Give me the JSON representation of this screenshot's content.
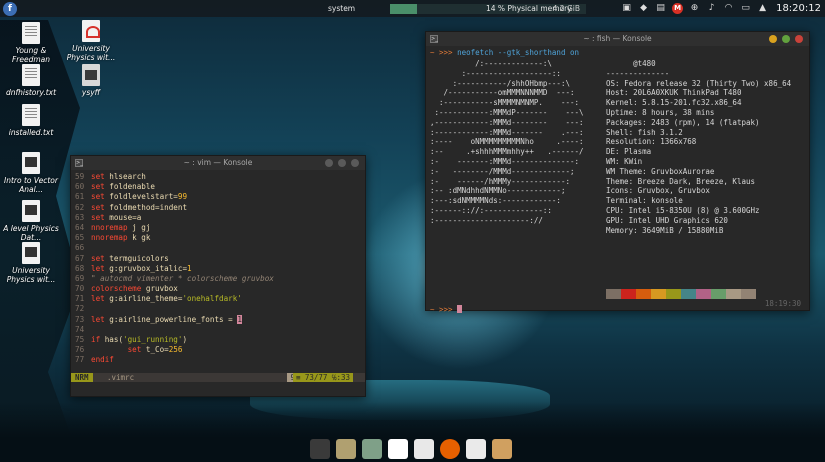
{
  "panel": {
    "sysmon_label": "system",
    "memory_text": "14 % Physical memory",
    "memory_fraction": 0.14,
    "memory_size": "4.2 GiB",
    "clock": "18:20:12",
    "gmail_badge": "M"
  },
  "desktop_icons": [
    {
      "label": "Young & Freedman"
    },
    {
      "label": "University Physics wit..."
    },
    {
      "label": "ysyff"
    },
    {
      "label": "dnfhistory.txt"
    },
    {
      "label": "installed.txt"
    },
    {
      "label": "Intro to Vector Anal..."
    },
    {
      "label": "A level Physics Dat..."
    },
    {
      "label": "University Physics wit..."
    }
  ],
  "vim": {
    "title": "~ : vim — Konsole",
    "mode": "NRM",
    "filename": ".vimrc",
    "percent": "94%",
    "position": "≡ 73/77 ℅:33",
    "lines": [
      {
        "n": "59",
        "t": "set hlsearch"
      },
      {
        "n": "60",
        "t": "set foldenable"
      },
      {
        "n": "61",
        "t": "set foldlevelstart=99"
      },
      {
        "n": "62",
        "t": "set foldmethod=indent"
      },
      {
        "n": "63",
        "t": "set mouse=a"
      },
      {
        "n": "64",
        "t": "nnoremap j gj"
      },
      {
        "n": "65",
        "t": "nnoremap k gk"
      },
      {
        "n": "66",
        "t": ""
      },
      {
        "n": "67",
        "t": "set termguicolors"
      },
      {
        "n": "68",
        "t": "let g:gruvbox_italic=1"
      },
      {
        "n": "69",
        "t": "\" autocmd vimenter * colorscheme gruvbox"
      },
      {
        "n": "70",
        "t": "colorscheme gruvbox"
      },
      {
        "n": "71",
        "t": "let g:airline_theme='onehalfdark'"
      },
      {
        "n": "72",
        "t": ""
      },
      {
        "n": "73",
        "t": "let g:airline_powerline_fonts = 1"
      },
      {
        "n": "74",
        "t": ""
      },
      {
        "n": "75",
        "t": "if has('gui_running')"
      },
      {
        "n": "76",
        "t": "        set t_Co=256"
      },
      {
        "n": "77",
        "t": "endif"
      }
    ]
  },
  "konsole": {
    "title": "~ : fish — Konsole",
    "prompt": "~ >>>",
    "command": "neofetch --gtk_shorthand on",
    "user_host": "@t480",
    "separator": "--------------",
    "logo_lines": [
      "          /:-------------:\\",
      "       :-------------------::",
      "     :-----------/shhOHbmp---:\\",
      "   /-----------omMMMNNNMMD  ---:",
      "  :-----------sMMMMNMNMP.    ---:",
      " :-----------:MMMdP-------    ---\\",
      ",------------:MMMd--------    ---:",
      ":------------:MMMd-------    .---:",
      ":----    oNMMMMMMMMMNho     .----:",
      ":--     .+shhhMMMmhhy++   .------/",
      ":-    -------:MMMd--------------:",
      ":-   --------/MMMd-------------;",
      ":-    ------/hMMMy------------:",
      ":-- :dMNdhhdNMMNo------------;",
      ":---:sdNMMMMNds:------------:",
      ":------:://:-------------::",
      ":---------------------://"
    ],
    "info": [
      {
        "k": "OS:",
        "v": "Fedora release 32 (Thirty Two) x86_64"
      },
      {
        "k": "Host:",
        "v": "20L6A0XKUK ThinkPad T480"
      },
      {
        "k": "Kernel:",
        "v": "5.8.15-201.fc32.x86_64"
      },
      {
        "k": "Uptime:",
        "v": "8 hours, 38 mins"
      },
      {
        "k": "Packages:",
        "v": "2483 (rpm), 14 (flatpak)"
      },
      {
        "k": "Shell:",
        "v": "fish 3.1.2"
      },
      {
        "k": "Resolution:",
        "v": "1366x768"
      },
      {
        "k": "DE:",
        "v": "Plasma"
      },
      {
        "k": "WM:",
        "v": "KWin"
      },
      {
        "k": "WM Theme:",
        "v": "GruvboxAurorae"
      },
      {
        "k": "Theme:",
        "v": "Breeze Dark, Breeze, Klaus"
      },
      {
        "k": "Icons:",
        "v": "Gruvbox, Gruvbox"
      },
      {
        "k": "Terminal:",
        "v": "konsole"
      },
      {
        "k": "CPU:",
        "v": "Intel i5-8350U (8) @ 3.600GHz"
      },
      {
        "k": "GPU:",
        "v": "Intel UHD Graphics 620"
      },
      {
        "k": "Memory:",
        "v": "3649MiB / 15880MiB"
      }
    ],
    "swatches": [
      "#7c6f64",
      "#cc241d",
      "#d65d0e",
      "#d79921",
      "#98971a",
      "#458588",
      "#b16286",
      "#689d6a",
      "#a89984",
      "#928374"
    ],
    "timestamp": "18:19:30"
  },
  "dock_colors": [
    "#3a3a3a",
    "#b0a070",
    "#7fa088",
    "#ffffff",
    "#e8e8e8",
    "#e66000",
    "#eaeaea",
    "#d0a060"
  ]
}
